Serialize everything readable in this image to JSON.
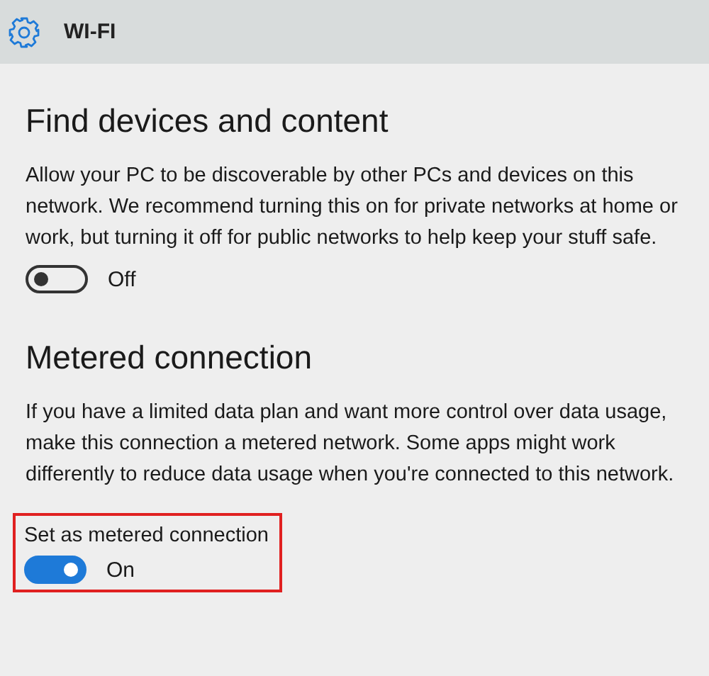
{
  "header": {
    "title": "WI-FI"
  },
  "sections": [
    {
      "heading": "Find devices and content",
      "description": "Allow your PC to be discoverable by other PCs and devices on this network. We recommend turning this on for private networks at home or work, but turning it off for public networks to help keep your stuff safe.",
      "toggle": {
        "on": false,
        "state_text": "Off"
      }
    },
    {
      "heading": "Metered connection",
      "description": "If you have a limited data plan and want more control over data usage, make this connection a metered network. Some apps might work differently to reduce data usage when you're connected to this network.",
      "setting_label": "Set as metered connection",
      "highlighted": true,
      "toggle": {
        "on": true,
        "state_text": "On"
      }
    }
  ]
}
